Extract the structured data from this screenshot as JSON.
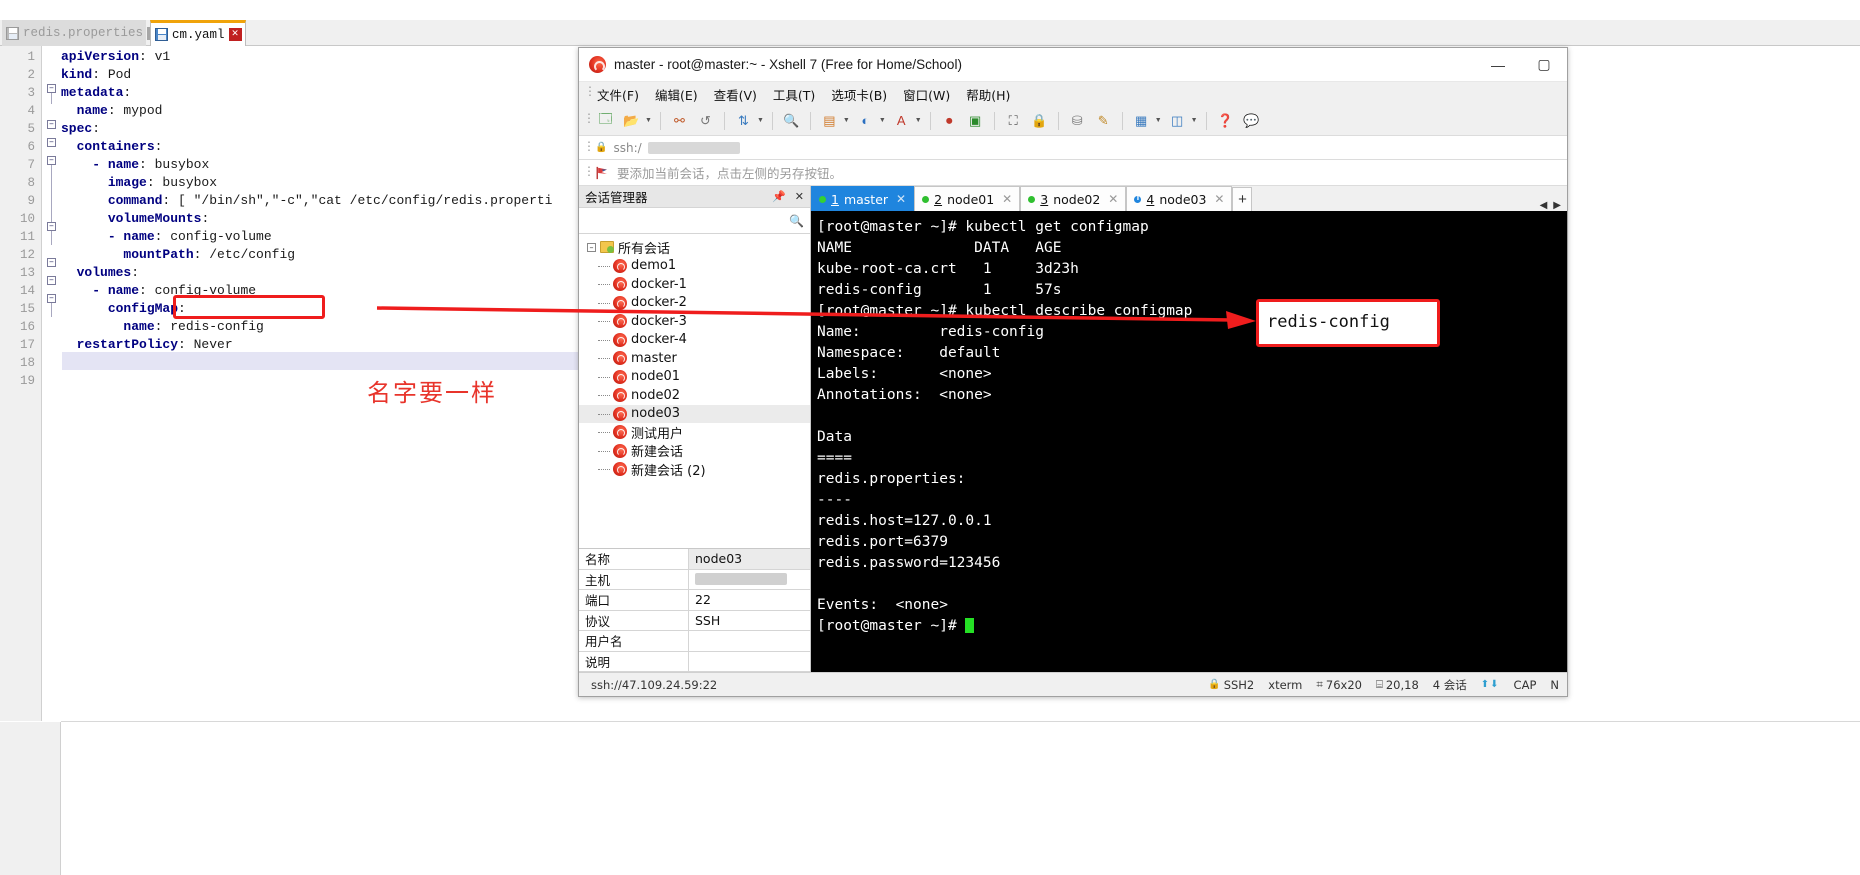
{
  "editor": {
    "tabs": [
      {
        "label": "redis.properties",
        "active": false
      },
      {
        "label": "cm.yaml",
        "active": true
      }
    ],
    "line_numbers": [
      "1",
      "2",
      "3",
      "4",
      "5",
      "6",
      "7",
      "8",
      "9",
      "10",
      "11",
      "12",
      "13",
      "14",
      "15",
      "16",
      "17",
      "18",
      "19"
    ],
    "code_lines": [
      {
        "indent": 0,
        "key": "apiVersion",
        "value": " v1"
      },
      {
        "indent": 0,
        "key": "kind",
        "value": " Pod"
      },
      {
        "indent": 0,
        "key": "metadata",
        "value": ""
      },
      {
        "indent": 2,
        "key": "name",
        "value": " mypod"
      },
      {
        "indent": 0,
        "key": "spec",
        "value": ""
      },
      {
        "indent": 2,
        "key": "containers",
        "value": ""
      },
      {
        "indent": 4,
        "key": "- name",
        "value": " busybox"
      },
      {
        "indent": 6,
        "key": "image",
        "value": " busybox"
      },
      {
        "indent": 6,
        "key": "command",
        "value": " [ \"/bin/sh\",\"-c\",\"cat /etc/config/redis.properti"
      },
      {
        "indent": 6,
        "key": "volumeMounts",
        "value": ""
      },
      {
        "indent": 6,
        "key": "- name",
        "value": " config-volume"
      },
      {
        "indent": 8,
        "key": "mountPath",
        "value": " /etc/config"
      },
      {
        "indent": 2,
        "key": "volumes",
        "value": ""
      },
      {
        "indent": 4,
        "key": "- name",
        "value": " config-volume"
      },
      {
        "indent": 6,
        "key": "configMap",
        "value": ""
      },
      {
        "indent": 8,
        "key": "name",
        "value": " redis-config"
      },
      {
        "indent": 2,
        "key": "restartPolicy",
        "value": " Never"
      },
      {
        "indent": 0,
        "key": "",
        "value": ""
      },
      {
        "indent": 0,
        "key": "",
        "value": ""
      }
    ],
    "annotation_note": "名字要一样",
    "highlight_color": "#ef1d1d"
  },
  "xshell": {
    "title": "master - root@master:~ - Xshell 7 (Free for Home/School)",
    "window_buttons": {
      "minimize": "—",
      "maximize": "▢",
      "close": "✕"
    },
    "menus": [
      "文件(F)",
      "编辑(E)",
      "查看(V)",
      "工具(T)",
      "选项卡(B)",
      "窗口(W)",
      "帮助(H)"
    ],
    "toolbar_icons": [
      "new-session-icon",
      "open-folder-icon",
      "disconnect-icon",
      "reconnect-icon",
      "transfer-icon",
      "find-icon",
      "layout-icon",
      "color-icon",
      "font-icon",
      "record-icon",
      "compose-icon",
      "fullscreen-icon",
      "lock-icon",
      "tunnel-icon",
      "highlight-icon",
      "properties-icon",
      "panes-icon",
      "help-icon",
      "comment-icon"
    ],
    "address": {
      "scheme": "ssh:/",
      "lock": "lock-icon"
    },
    "info_bar": {
      "text": "要添加当前会话，点击左侧的另存按钮。",
      "icon": "flag-icon"
    },
    "session_manager": {
      "title": "会话管理器",
      "pin_icon": "pin-icon",
      "close_icon": "close-icon",
      "search_placeholder": "",
      "search_value": "",
      "root": "所有会话",
      "sessions": [
        "demo1",
        "docker-1",
        "docker-2",
        "docker-3",
        "docker-4",
        "master",
        "node01",
        "node02",
        "node03",
        "测试用户",
        "新建会话",
        "新建会话 (2)"
      ],
      "selected_session": "node03",
      "properties": [
        {
          "key": "名称",
          "value": "node03",
          "selected": true
        },
        {
          "key": "主机",
          "value": "",
          "blurred": true
        },
        {
          "key": "端口",
          "value": "22"
        },
        {
          "key": "协议",
          "value": "SSH"
        },
        {
          "key": "用户名",
          "value": ""
        },
        {
          "key": "说明",
          "value": ""
        }
      ]
    },
    "terminal_tabs": [
      {
        "num": "1",
        "label": "master",
        "active": true,
        "state": "connected"
      },
      {
        "num": "2",
        "label": "node01",
        "active": false,
        "state": "connected"
      },
      {
        "num": "3",
        "label": "node02",
        "active": false,
        "state": "connected"
      },
      {
        "num": "4",
        "label": "node03",
        "active": false,
        "state": "info"
      }
    ],
    "new_tab_label": "+",
    "terminal_lines": [
      "[root@master ~]# kubectl get configmap",
      "NAME              DATA   AGE",
      "kube-root-ca.crt   1     3d23h",
      "redis-config       1     57s",
      "[root@master ~]# kubectl describe configmap",
      "Name:         redis-config",
      "Namespace:    default",
      "Labels:       <none>",
      "Annotations:  <none>",
      "",
      "Data",
      "====",
      "redis.properties:",
      "----",
      "redis.host=127.0.0.1",
      "redis.port=6379",
      "redis.password=123456",
      "",
      "Events:  <none>"
    ],
    "terminal_prompt": "[root@master ~]# ",
    "callout_text": "redis-config",
    "status_bar": {
      "connection": "ssh://47.109.24.59:22",
      "security": "SSH2",
      "term_type": "xterm",
      "size": "76x20",
      "cursor": "20,18",
      "sessions": "4 会话",
      "caps": "CAP",
      "num": "N"
    }
  }
}
